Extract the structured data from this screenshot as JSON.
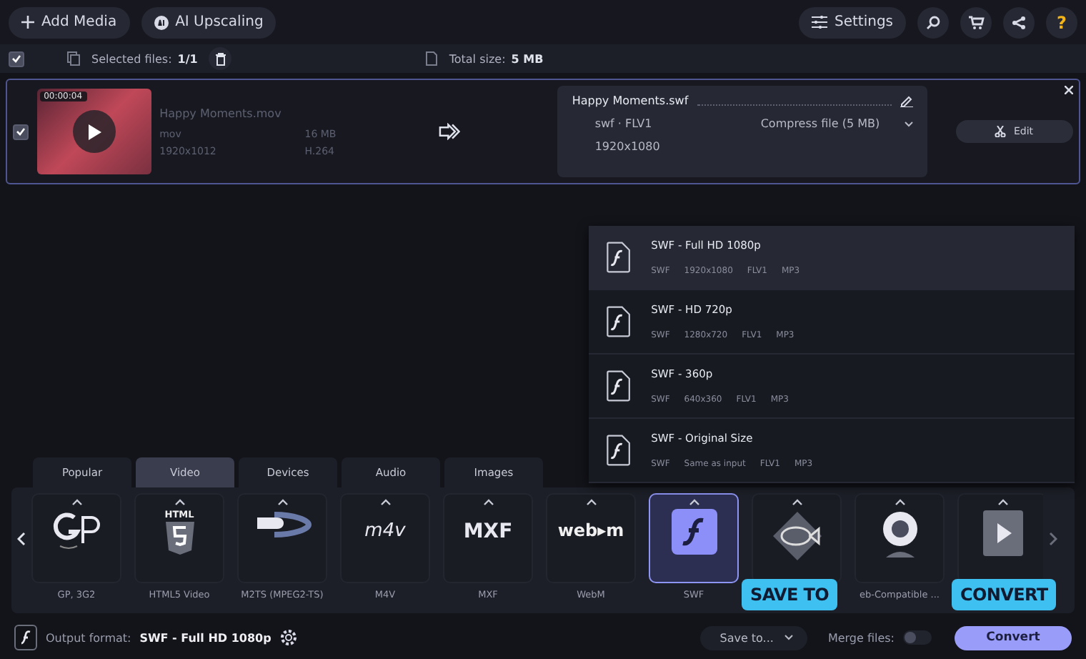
{
  "toolbar": {
    "left": [
      {
        "kind": "add",
        "label": "Add Media"
      },
      {
        "kind": "ai",
        "label": "AI Upscaling"
      }
    ],
    "settings": "Settings",
    "icons": [
      {
        "kind": "search"
      },
      {
        "kind": "cart"
      },
      {
        "kind": "share"
      },
      {
        "kind": "help",
        "label": "?"
      }
    ]
  },
  "selection_bar": {
    "checked": true,
    "selected_label": "Selected files:",
    "selected_value": "1/1",
    "total_label": "Total size:",
    "total_value": "5 MB"
  },
  "file": {
    "checked": true,
    "duration": "00:00:04",
    "name": "Happy Moments.mov",
    "format": "mov",
    "size": "16 MB",
    "resolution": "1920x1012",
    "codec": "H.264",
    "output": {
      "name": "Happy Moments.swf",
      "format": "swf · FLV1",
      "compress": "Compress file (5 MB)",
      "resolution": "1920x1080"
    },
    "edit": "Edit"
  },
  "presets": [
    {
      "title": "SWF - Full HD 1080p",
      "specs": [
        "SWF",
        "1920x1080",
        "FLV1",
        "MP3"
      ],
      "selected": true
    },
    {
      "title": "SWF - HD 720p",
      "specs": [
        "SWF",
        "1280x720",
        "FLV1",
        "MP3"
      ],
      "selected": false
    },
    {
      "title": "SWF - 360p",
      "specs": [
        "SWF",
        "640x360",
        "FLV1",
        "MP3"
      ],
      "selected": false
    },
    {
      "title": "SWF - Original Size",
      "specs": [
        "SWF",
        "Same as input",
        "FLV1",
        "MP3"
      ],
      "selected": false
    }
  ],
  "tabs": [
    {
      "label": "Popular",
      "selected": false
    },
    {
      "label": "Video",
      "selected": true
    },
    {
      "label": "Devices",
      "selected": false
    },
    {
      "label": "Audio",
      "selected": false
    },
    {
      "label": "Images",
      "selected": false
    }
  ],
  "formats": [
    {
      "kind": "threegp",
      "label": "GP, 3G2",
      "selected": false
    },
    {
      "kind": "html5",
      "icon_text": "HTML",
      "label": "HTML5 Video",
      "selected": false
    },
    {
      "kind": "bluray",
      "label": "M2TS (MPEG2-TS)",
      "selected": false
    },
    {
      "kind": "m4v",
      "icon_text": "m4v",
      "label": "M4V",
      "selected": false
    },
    {
      "kind": "mxf",
      "icon_text": "MXF",
      "label": "MXF",
      "selected": false
    },
    {
      "kind": "webm",
      "icon_text": "web▸m",
      "label": "WebM",
      "selected": false
    },
    {
      "kind": "swf",
      "label": "SWF",
      "selected": true
    },
    {
      "kind": "fish",
      "selected": false
    },
    {
      "kind": "webcam",
      "label": "eb-Compatible ...",
      "selected": false
    },
    {
      "kind": "film",
      "selected": false
    }
  ],
  "bottom_bar": {
    "output_label": "Output format:",
    "output_value": "SWF - Full HD 1080p",
    "save_to": "Save to...",
    "merge_label": "Merge files:",
    "merge_on": false,
    "convert": "Convert"
  },
  "callouts": [
    {
      "kind": "save",
      "label": "SAVE TO"
    },
    {
      "kind": "convert",
      "label": "CONVERT"
    }
  ]
}
